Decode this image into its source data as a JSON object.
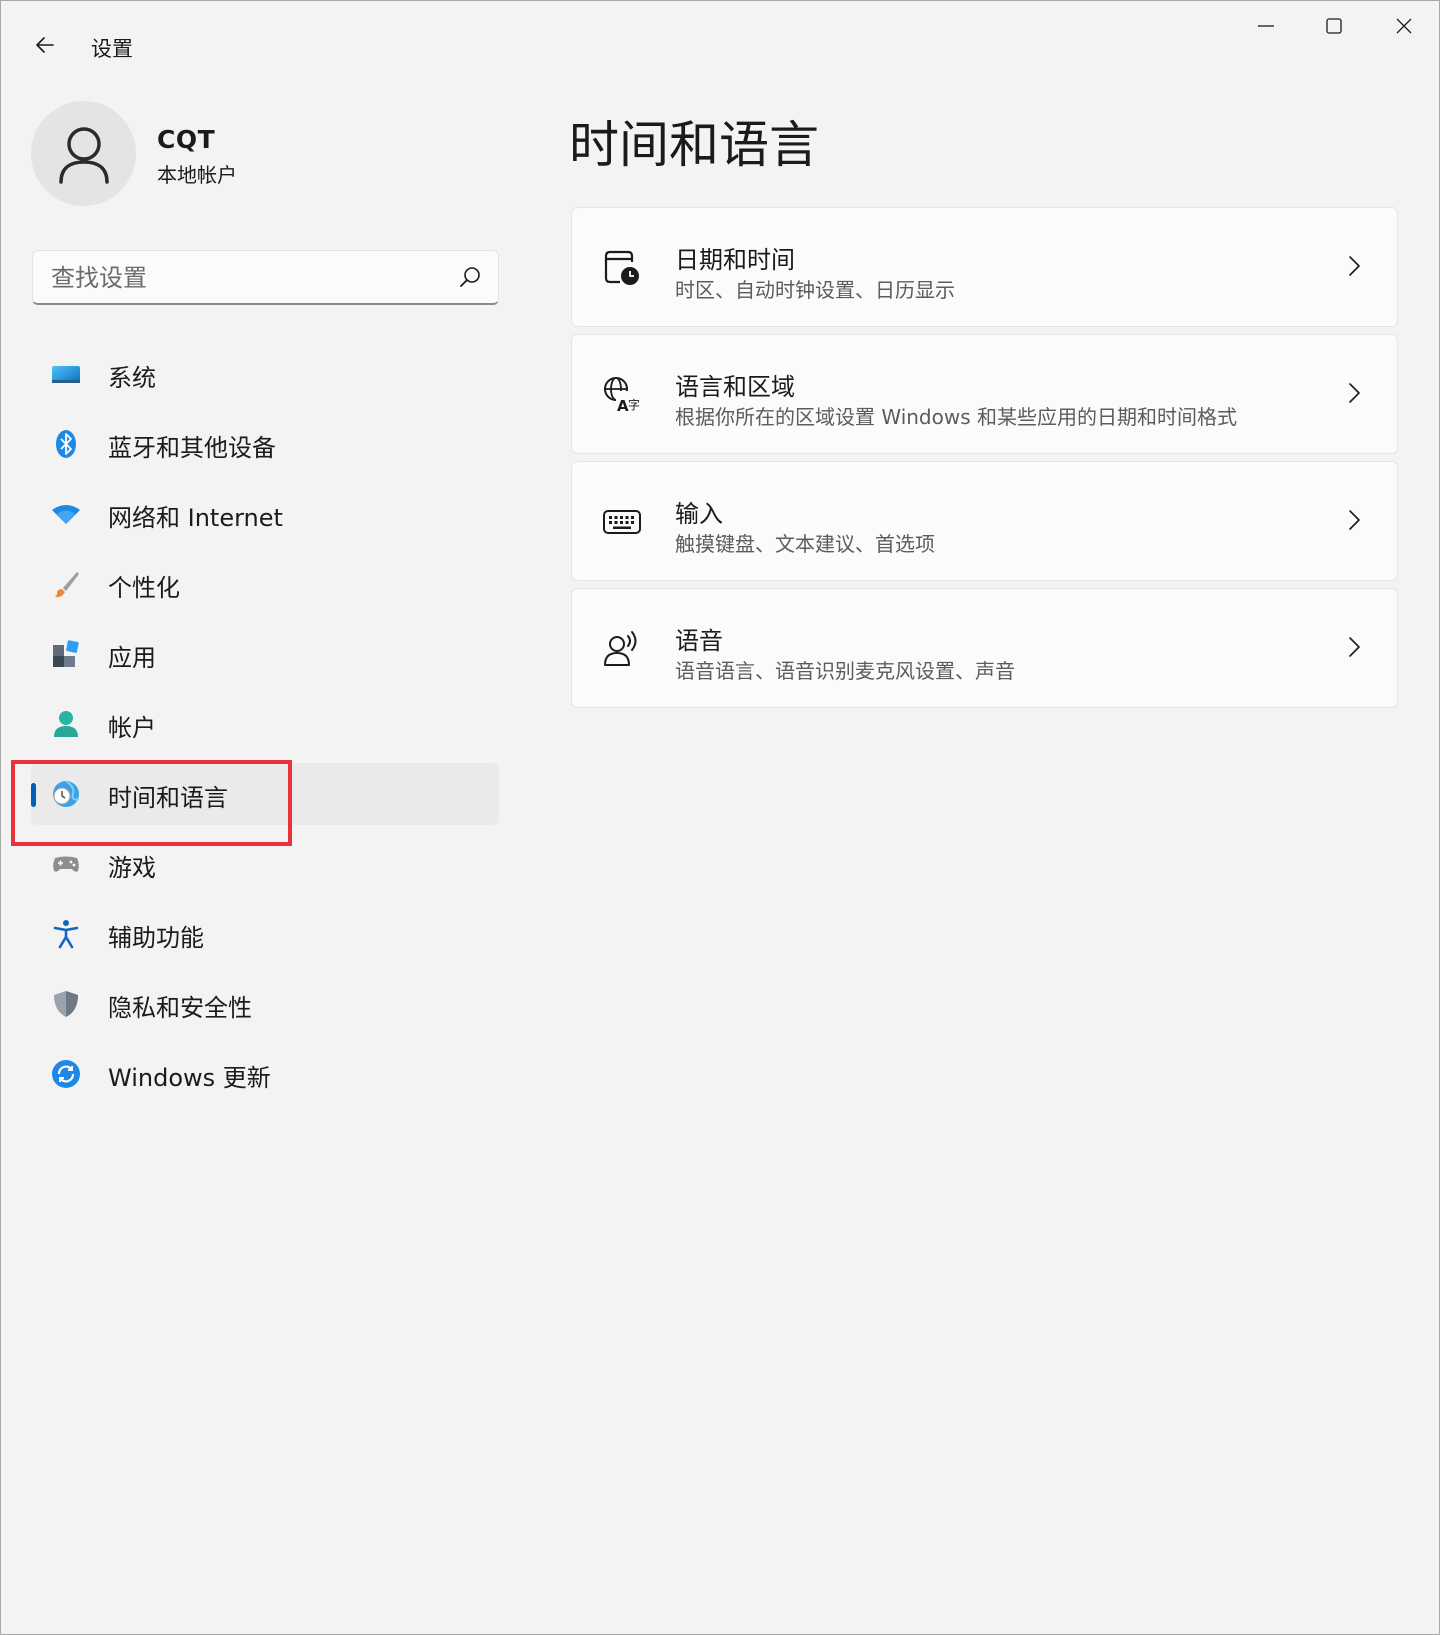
{
  "window": {
    "title": "设置",
    "controls": [
      "minimize",
      "maximize",
      "close"
    ]
  },
  "profile": {
    "name": "CQT",
    "account_type": "本地帐户"
  },
  "search": {
    "placeholder": "查找设置",
    "value": ""
  },
  "sidebar": {
    "active_index": 6,
    "items": [
      {
        "label": "系统",
        "icon": "system-icon"
      },
      {
        "label": "蓝牙和其他设备",
        "icon": "bluetooth-icon"
      },
      {
        "label": "网络和 Internet",
        "icon": "wifi-icon"
      },
      {
        "label": "个性化",
        "icon": "brush-icon"
      },
      {
        "label": "应用",
        "icon": "apps-icon"
      },
      {
        "label": "帐户",
        "icon": "account-icon"
      },
      {
        "label": "时间和语言",
        "icon": "globe-clock-icon"
      },
      {
        "label": "游戏",
        "icon": "gamepad-icon"
      },
      {
        "label": "辅助功能",
        "icon": "accessibility-icon"
      },
      {
        "label": "隐私和安全性",
        "icon": "shield-icon"
      },
      {
        "label": "Windows 更新",
        "icon": "update-icon"
      }
    ]
  },
  "main": {
    "title": "时间和语言",
    "cards": [
      {
        "title": "日期和时间",
        "description": "时区、自动时钟设置、日历显示",
        "icon": "calendar-clock-icon"
      },
      {
        "title": "语言和区域",
        "description": "根据你所在的区域设置 Windows 和某些应用的日期和时间格式",
        "icon": "language-icon"
      },
      {
        "title": "输入",
        "description": "触摸键盘、文本建议、首选项",
        "icon": "keyboard-icon"
      },
      {
        "title": "语音",
        "description": "语音语言、语音识别麦克风设置、声音",
        "icon": "speech-icon"
      }
    ]
  },
  "colors": {
    "accent": "#005fb8",
    "highlight_box": "#e8333a",
    "background": "#f3f3f3",
    "card": "#fbfbfb"
  }
}
